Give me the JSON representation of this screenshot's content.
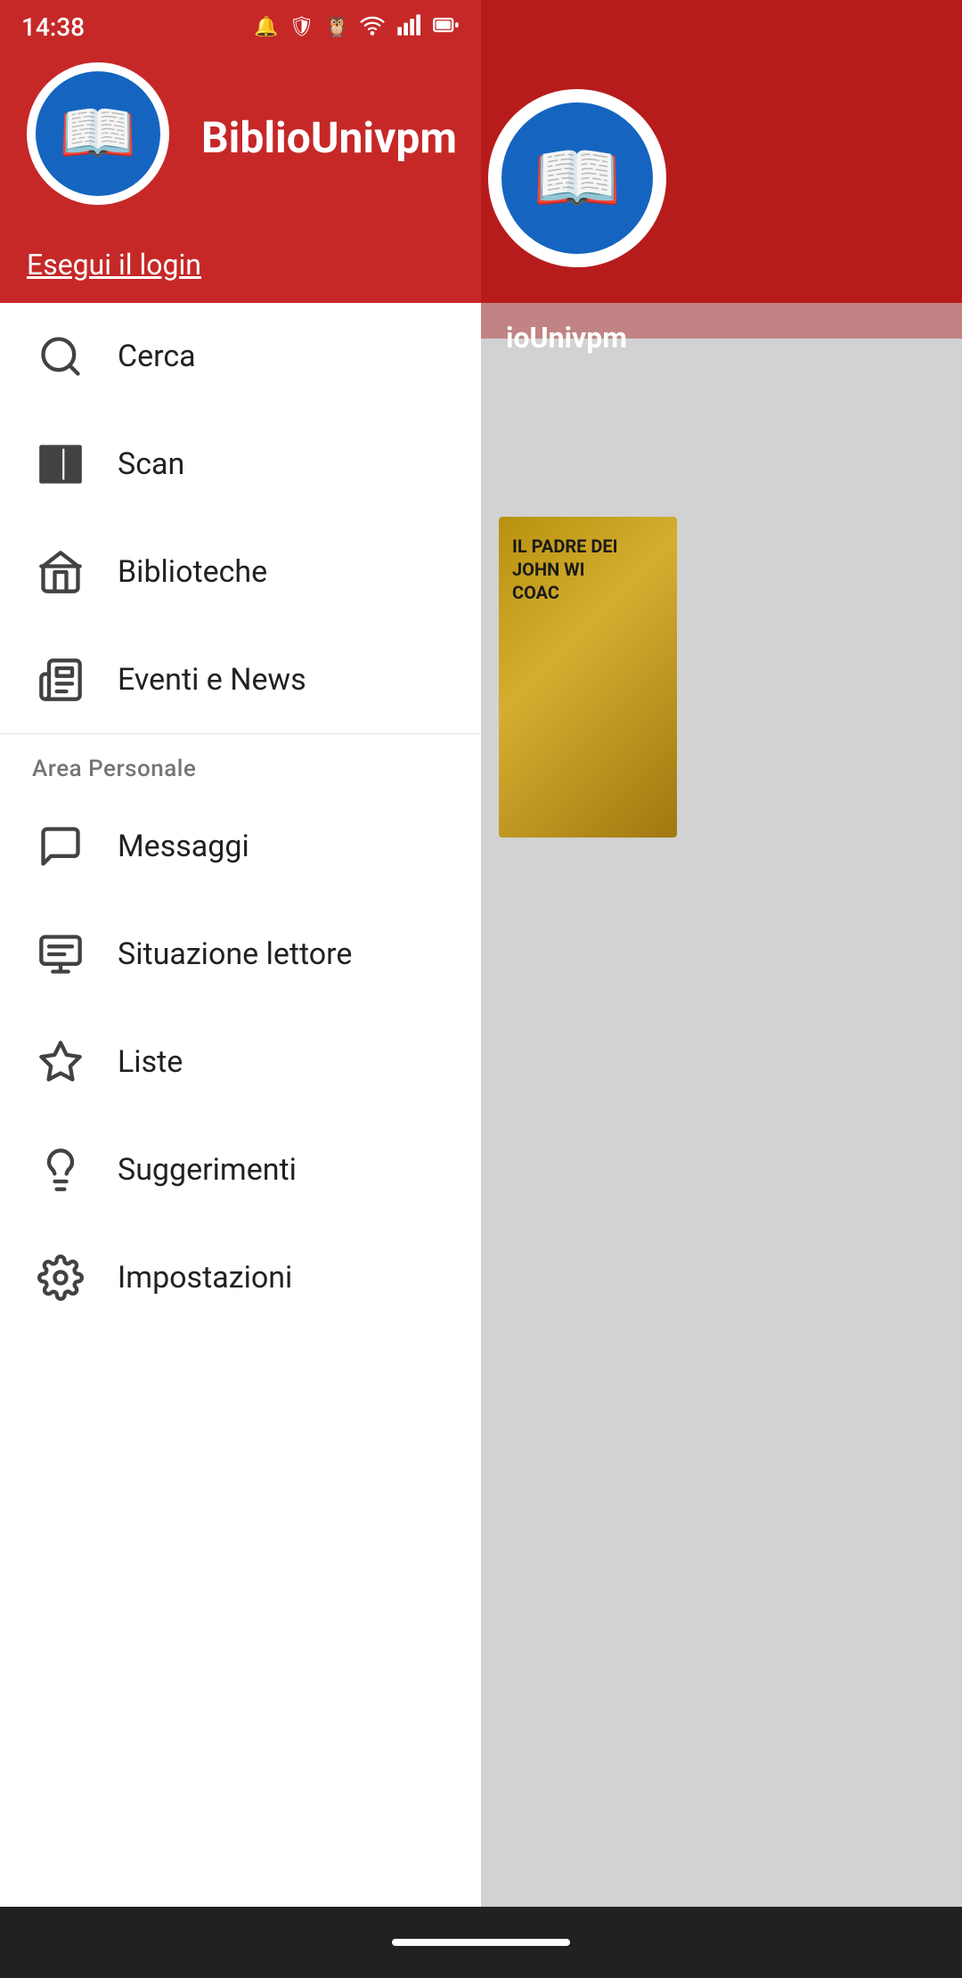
{
  "app": {
    "name": "BiblioUnivpm",
    "logo_icon": "📖"
  },
  "status_bar": {
    "time": "14:38",
    "icons": [
      "notification",
      "shield",
      "owl",
      "wifi",
      "signal",
      "battery"
    ]
  },
  "header": {
    "login_label": "Esegui il login"
  },
  "menu": {
    "items": [
      {
        "id": "cerca",
        "label": "Cerca",
        "icon": "search"
      },
      {
        "id": "scan",
        "label": "Scan",
        "icon": "barcode"
      },
      {
        "id": "biblioteche",
        "label": "Biblioteche",
        "icon": "library"
      },
      {
        "id": "eventi",
        "label": "Eventi e News",
        "icon": "news"
      }
    ],
    "section_personal": {
      "label": "Area Personale",
      "items": [
        {
          "id": "messaggi",
          "label": "Messaggi",
          "icon": "chat"
        },
        {
          "id": "situazione",
          "label": "Situazione lettore",
          "icon": "reader"
        },
        {
          "id": "liste",
          "label": "Liste",
          "icon": "star"
        },
        {
          "id": "suggerimenti",
          "label": "Suggerimenti",
          "icon": "lightbulb"
        },
        {
          "id": "impostazioni",
          "label": "Impostazioni",
          "icon": "gear"
        }
      ]
    }
  },
  "background": {
    "book_title": "IL PADRE DEI\nJOHN WI\nCOAC",
    "biblio_label": "ioUnivpm"
  }
}
